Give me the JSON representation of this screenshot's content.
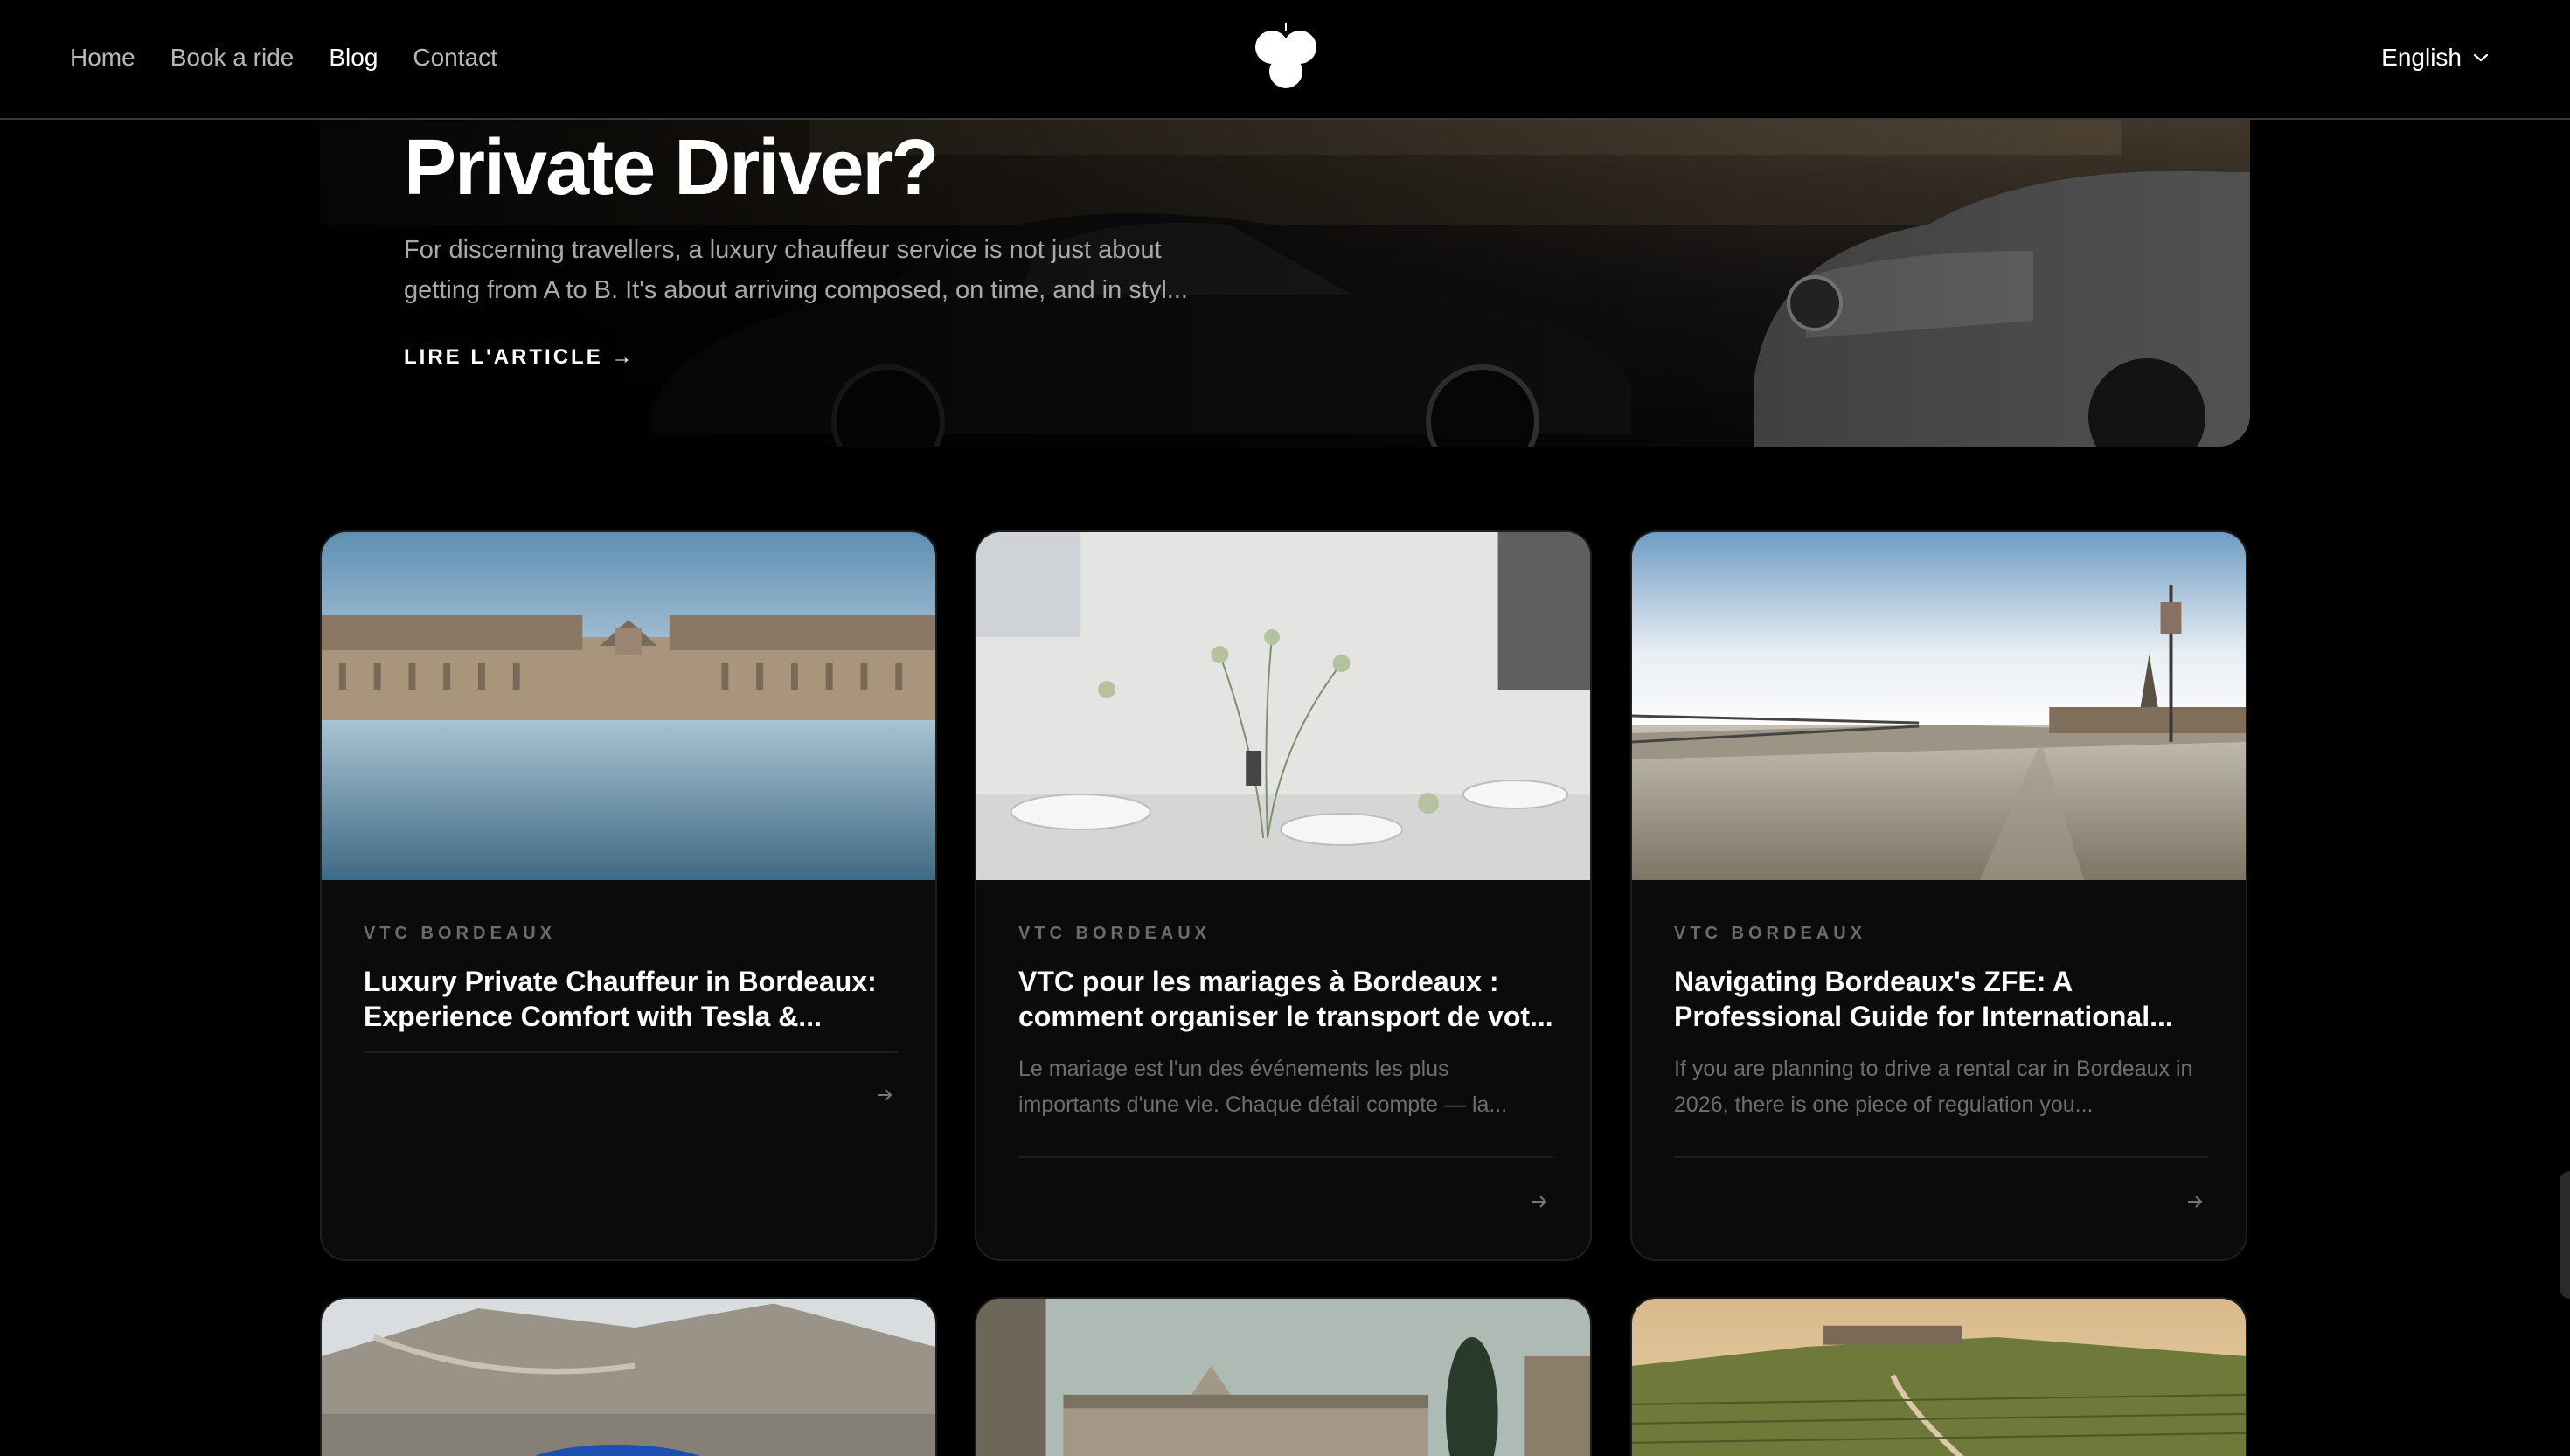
{
  "nav": {
    "items": [
      {
        "label": "Home",
        "active": false
      },
      {
        "label": "Book a ride",
        "active": false
      },
      {
        "label": "Blog",
        "active": true
      },
      {
        "label": "Contact",
        "active": false
      }
    ],
    "language": "English"
  },
  "hero": {
    "title": "Private Driver?",
    "excerpt": "For discerning travellers, a luxury chauffeur service is not just about getting from A to B. It's about arriving composed, on time, and in styl...",
    "cta": "LIRE L'ARTICLE →"
  },
  "cards": [
    {
      "category": "VTC BORDEAUX",
      "title": "Luxury Private Chauffeur in Bordeaux: Experience Comfort with Tesla &...",
      "excerpt": ""
    },
    {
      "category": "VTC BORDEAUX",
      "title": "VTC pour les mariages à Bordeaux : comment organiser le transport de vot...",
      "excerpt": "Le mariage est l'un des événements les plus importants d'une vie. Chaque détail compte — la..."
    },
    {
      "category": "VTC BORDEAUX",
      "title": "Navigating Bordeaux's ZFE: A Professional Guide for International...",
      "excerpt": "If you are planning to drive a rental car in Bordeaux in 2026, there is one piece of regulation you..."
    }
  ],
  "colors": {
    "background": "#000000",
    "card": "#0b0b0b",
    "muted_text": "#6e6e6e"
  }
}
